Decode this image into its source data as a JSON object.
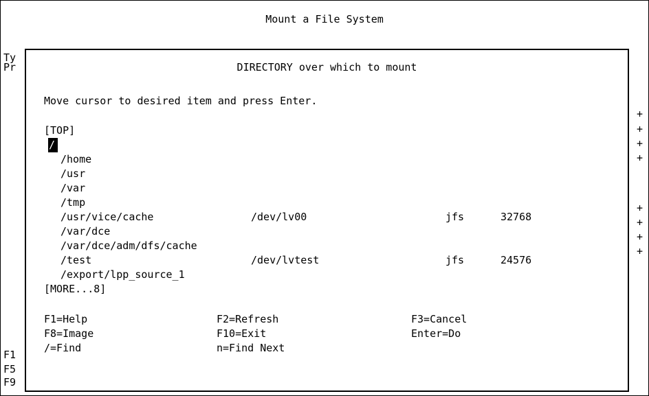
{
  "screen": {
    "title": "Mount a File System",
    "background_chars": [
      "Ty",
      "Pr",
      "F1",
      "F5",
      "F9"
    ],
    "plus_marker": "+"
  },
  "popup": {
    "title": "DIRECTORY over which to mount",
    "instruction": "Move cursor to desired item and press Enter.",
    "list_top": "[TOP]",
    "list_more": "[MORE...8]",
    "items": [
      {
        "dir": "/",
        "device": "",
        "fstype": "",
        "size": "",
        "selected": true
      },
      {
        "dir": "/home",
        "device": "",
        "fstype": "",
        "size": ""
      },
      {
        "dir": "/usr",
        "device": "",
        "fstype": "",
        "size": ""
      },
      {
        "dir": "/var",
        "device": "",
        "fstype": "",
        "size": ""
      },
      {
        "dir": "/tmp",
        "device": "",
        "fstype": "",
        "size": ""
      },
      {
        "dir": "/usr/vice/cache",
        "device": "/dev/lv00",
        "fstype": "jfs",
        "size": "32768"
      },
      {
        "dir": "/var/dce",
        "device": "",
        "fstype": "",
        "size": ""
      },
      {
        "dir": "/var/dce/adm/dfs/cache",
        "device": "",
        "fstype": "",
        "size": ""
      },
      {
        "dir": "/test",
        "device": "/dev/lvtest",
        "fstype": "jfs",
        "size": "24576"
      },
      {
        "dir": "/export/lpp_source_1",
        "device": "",
        "fstype": "",
        "size": ""
      }
    ],
    "function_keys": [
      [
        "F1=Help",
        "F2=Refresh",
        "F3=Cancel"
      ],
      [
        "F8=Image",
        "F10=Exit",
        "Enter=Do"
      ],
      [
        "/=Find",
        "n=Find Next",
        ""
      ]
    ]
  }
}
